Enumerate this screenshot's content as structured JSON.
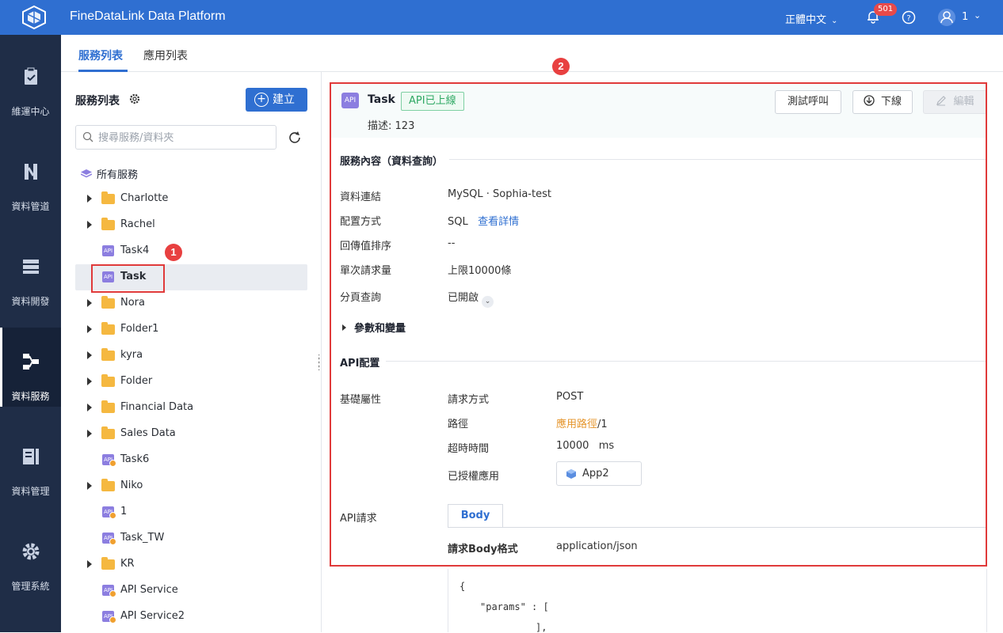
{
  "app": {
    "title": "FineDataLink Data Platform"
  },
  "topbar": {
    "language": "正體中文",
    "notifications": "501",
    "user": "1"
  },
  "sidenav": [
    {
      "label": "維運中心",
      "icon": "clipboard-check-icon"
    },
    {
      "label": "資料管道",
      "icon": "pipeline-icon"
    },
    {
      "label": "資料開發",
      "icon": "dev-icon"
    },
    {
      "label": "資料服務",
      "icon": "service-icon"
    },
    {
      "label": "資料管理",
      "icon": "data-manage-icon"
    },
    {
      "label": "管理系統",
      "icon": "gear-icon"
    }
  ],
  "tabs": [
    "服務列表",
    "應用列表"
  ],
  "left": {
    "title": "服務列表",
    "create_label": "建立",
    "search_placeholder": "搜尋服務/資料夾",
    "root_label": "所有服務",
    "items": [
      {
        "name": "Charlotte",
        "type": "folder"
      },
      {
        "name": "Rachel",
        "type": "folder"
      },
      {
        "name": "Task4",
        "type": "api"
      },
      {
        "name": "Task",
        "type": "api-selected"
      },
      {
        "name": "Nora",
        "type": "folder"
      },
      {
        "name": "Folder1",
        "type": "folder"
      },
      {
        "name": "kyra",
        "type": "folder"
      },
      {
        "name": "Folder",
        "type": "folder"
      },
      {
        "name": "Financial Data",
        "type": "folder"
      },
      {
        "name": "Sales Data",
        "type": "folder"
      },
      {
        "name": "Task6",
        "type": "api-warn"
      },
      {
        "name": "Niko",
        "type": "folder"
      },
      {
        "name": "1",
        "type": "api-warn"
      },
      {
        "name": "Task_TW",
        "type": "api-warn"
      },
      {
        "name": "KR",
        "type": "folder"
      },
      {
        "name": "API Service",
        "type": "api-warn"
      },
      {
        "name": "API Service2",
        "type": "api-warn"
      }
    ]
  },
  "markers": {
    "one": "1",
    "two": "2"
  },
  "detail": {
    "api_badge": "API",
    "title": "Task",
    "status": "API已上線",
    "desc_label": "描述:",
    "desc_value": "123",
    "btn_test": "測試呼叫",
    "btn_offline": "下線",
    "btn_edit": "編輯",
    "section_content": "服務內容（資料查詢）",
    "content": {
      "conn_k": "資料連結",
      "conn_v": "MySQL · Sophia-test",
      "config_k": "配置方式",
      "config_v": "SQL",
      "config_link": "查看詳情",
      "sort_k": "回傳值排序",
      "sort_v": "--",
      "limit_k": "單次請求量",
      "limit_v": "上限10000條",
      "page_k": "分頁查詢",
      "page_v": "已開啟"
    },
    "params_label": "參數和變量",
    "section_api": "API配置",
    "api": {
      "base_k": "基礎屬性",
      "method_k": "請求方式",
      "method_v": "POST",
      "path_k": "路徑",
      "path_v_link": "應用路徑",
      "path_v": "/1",
      "timeout_k": "超時時間",
      "timeout_v": "10000   ms",
      "app_k": "已授權應用",
      "app_v": "App2"
    },
    "request": {
      "k": "API請求",
      "tab": "Body",
      "format_k": "請求Body格式",
      "format_v": "application/json",
      "code": [
        "{",
        "\"params\" : [",
        "],"
      ]
    }
  }
}
